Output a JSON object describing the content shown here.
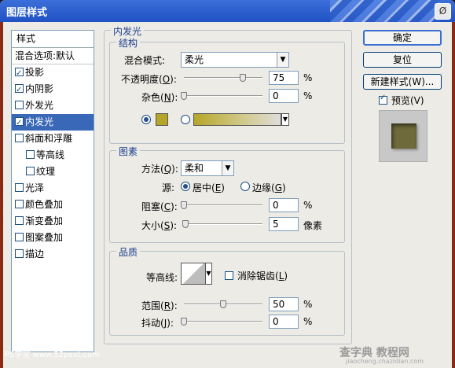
{
  "window": {
    "title": "图层样式",
    "close_glyph": "Ø"
  },
  "styles_list": {
    "header": "样式",
    "blend_options": "混合选项:默认",
    "items": [
      {
        "label": "投影",
        "checked": true
      },
      {
        "label": "内阴影",
        "checked": true
      },
      {
        "label": "外发光",
        "checked": false
      },
      {
        "label": "内发光",
        "checked": true,
        "selected": true
      },
      {
        "label": "斜面和浮雕",
        "checked": false
      },
      {
        "label": "等高线",
        "checked": false,
        "sub": true
      },
      {
        "label": "纹理",
        "checked": false,
        "sub": true
      },
      {
        "label": "光泽",
        "checked": false
      },
      {
        "label": "颜色叠加",
        "checked": false
      },
      {
        "label": "渐变叠加",
        "checked": false
      },
      {
        "label": "图案叠加",
        "checked": false
      },
      {
        "label": "描边",
        "checked": false
      }
    ]
  },
  "panel_title": "内发光",
  "structure": {
    "legend": "结构",
    "blend_mode_label": "混合模式:",
    "blend_mode_value": "柔光",
    "opacity_label": "不透明度(",
    "opacity_key": "O",
    "opacity_value": "75",
    "noise_label": "杂色(",
    "noise_key": "N",
    "noise_value": "0",
    "percent": "%",
    "glow_color": "#b5a62a"
  },
  "elements": {
    "legend": "图素",
    "method_label": "方法(",
    "method_key": "Q",
    "method_value": "柔和",
    "source_label": "源:",
    "source_center": "居中(",
    "source_center_key": "E",
    "source_edge": "边缘(",
    "source_edge_key": "G",
    "choke_label": "阻塞(",
    "choke_key": "C",
    "choke_value": "0",
    "size_label": "大小(",
    "size_key": "S",
    "size_value": "5",
    "size_unit": "像素"
  },
  "quality": {
    "legend": "品质",
    "contour_label": "等高线:",
    "antialias_label": "消除锯齿(",
    "antialias_key": "L",
    "range_label": "范围(",
    "range_key": "R",
    "range_value": "50",
    "jitter_label": "抖动(",
    "jitter_key": "J",
    "jitter_value": "0"
  },
  "buttons": {
    "ok": "确定",
    "reset": "复位",
    "new_style": "新建样式(W)...",
    "preview_label": "预览(V)"
  },
  "watermarks": {
    "left": "PS学堂 www.52psxt.com",
    "right_top": "查字典 教程网",
    "right_bottom": "jiaocheng.chazidian.com"
  },
  "sliders": {
    "opacity": 0.75,
    "noise": 0,
    "choke": 0,
    "size": 0.02,
    "range": 0.5,
    "jitter": 0
  }
}
